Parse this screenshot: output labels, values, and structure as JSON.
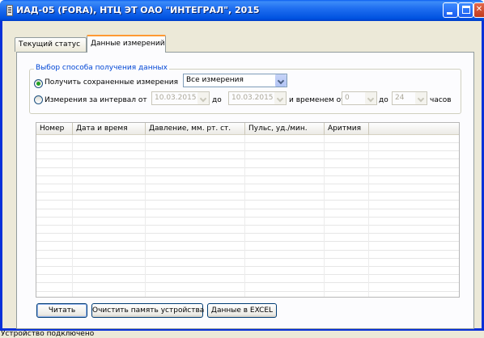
{
  "window": {
    "title": "ИАД-05 (FORA), НТЦ ЭТ ОАО \"ИНТЕГРАЛ\", 2015"
  },
  "tabs": [
    {
      "label": "Текущий статус",
      "selected": false
    },
    {
      "label": "Данные измерений",
      "selected": true
    }
  ],
  "data_source": {
    "group_title": "Выбор способа получения данных",
    "option_saved": {
      "label": "Получить сохраненные измерения",
      "checked": true,
      "select_value": "Все измерения"
    },
    "option_interval": {
      "label": "Измерения за интервал от",
      "checked": false,
      "date_from": "10.03.2015",
      "date_to_label": "до",
      "date_to": "10.03.2015",
      "time_label": "и временем от",
      "hour_from": "0",
      "hour_to_label": "до",
      "hour_to": "24",
      "hours_label": "часов"
    }
  },
  "table": {
    "columns": [
      "Номер",
      "Дата и время",
      "Давление, мм. рт. ст.",
      "Пульс, уд./мин.",
      "Аритмия"
    ],
    "rows": []
  },
  "buttons": {
    "read": "Читать",
    "clear_memory": "Очистить память устройства",
    "export_excel": "Данные в EXCEL"
  },
  "status_bar": {
    "text": "Устройство подключено"
  }
}
